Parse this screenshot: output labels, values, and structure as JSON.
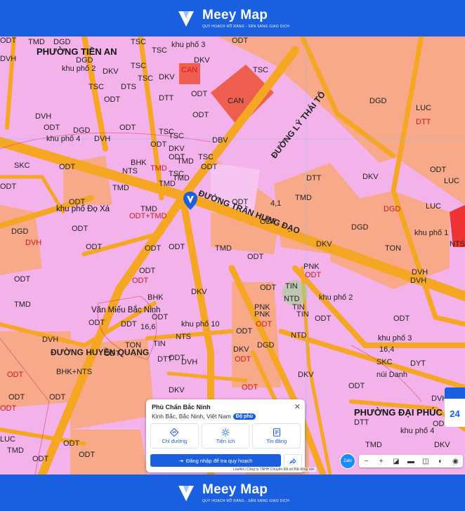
{
  "brand": {
    "name": "Meey Map",
    "tagline": "QUY HOẠCH RÕ RÀNG - SẴN SÀNG GIAO DỊCH"
  },
  "colors": {
    "primary": "#1a5fe0",
    "residential": "#f4b2ea",
    "commercial": "#f7a98a",
    "road": "#f5a623",
    "special": "#ef5f4f"
  },
  "map": {
    "labels": [
      {
        "t": "PHƯỜNG TIỀN AN",
        "c": "big"
      },
      {
        "t": "TMD"
      },
      {
        "t": "DGD"
      },
      {
        "t": "TSC"
      },
      {
        "t": "TSC"
      },
      {
        "t": "khu phố 3"
      },
      {
        "t": "ODT"
      },
      {
        "t": "khu phố 2"
      },
      {
        "t": "DKV"
      },
      {
        "t": "CAN",
        "c": "red"
      },
      {
        "t": "DKV"
      },
      {
        "t": "DGD"
      },
      {
        "t": "DVH"
      },
      {
        "t": "DKV"
      },
      {
        "t": "TSC"
      },
      {
        "t": "TSC"
      },
      {
        "t": "ODT"
      },
      {
        "t": "DTS"
      },
      {
        "t": "ODT"
      },
      {
        "t": "DTT"
      },
      {
        "t": "TSC"
      },
      {
        "t": "ĐƯỜNG LÝ THÁI TỔ",
        "c": "road"
      },
      {
        "t": "CAN"
      },
      {
        "t": "TSC"
      },
      {
        "t": "DGD"
      },
      {
        "t": "LUC"
      },
      {
        "t": "DTT",
        "c": "red"
      },
      {
        "t": "DVH"
      },
      {
        "t": "ODT"
      },
      {
        "t": "ODT"
      },
      {
        "t": "ODT"
      },
      {
        "t": "DGD"
      },
      {
        "t": "khu phố 4"
      },
      {
        "t": "DVH"
      },
      {
        "t": "ODT"
      },
      {
        "t": "TSC"
      },
      {
        "t": "DKV"
      },
      {
        "t": "DBV"
      },
      {
        "t": "TSC"
      },
      {
        "t": "TSC"
      },
      {
        "t": "ODT"
      },
      {
        "t": "TMD",
        "c": "red"
      },
      {
        "t": "SKC"
      },
      {
        "t": "ODT"
      },
      {
        "t": "TMD"
      },
      {
        "t": "TSC"
      },
      {
        "t": "NTS"
      },
      {
        "t": "BHK"
      },
      {
        "t": "TMD"
      },
      {
        "t": "TMD"
      },
      {
        "t": "ODT"
      },
      {
        "t": "DTT"
      },
      {
        "t": "DKV"
      },
      {
        "t": "ODT"
      },
      {
        "t": "LUC"
      },
      {
        "t": "ODT"
      },
      {
        "t": "ODT"
      },
      {
        "t": "TMD"
      },
      {
        "t": "khu phố Đọ Xá",
        "c": "place"
      },
      {
        "t": "TMD"
      },
      {
        "t": "ODT+TMD",
        "c": "red"
      },
      {
        "t": "ĐƯỜNG TRẦN HƯNG ĐẠO",
        "c": "road"
      },
      {
        "t": "ODT"
      },
      {
        "t": "ODT"
      },
      {
        "t": "4,1"
      },
      {
        "t": "TMD"
      },
      {
        "t": "DGD"
      },
      {
        "t": "LUC"
      },
      {
        "t": "DGD",
        "c": "red"
      },
      {
        "t": "DGD"
      },
      {
        "t": "DVH",
        "c": "red"
      },
      {
        "t": "ODT"
      },
      {
        "t": "ODT"
      },
      {
        "t": "ODT"
      },
      {
        "t": "ODT"
      },
      {
        "t": "TMD"
      },
      {
        "t": "DKV"
      },
      {
        "t": "TON"
      },
      {
        "t": "khu phố 1"
      },
      {
        "t": "NTS"
      },
      {
        "t": "DVH"
      },
      {
        "t": "ODT"
      },
      {
        "t": "ODT"
      },
      {
        "t": "ODT"
      },
      {
        "t": "PNK"
      },
      {
        "t": "ODT",
        "c": "red"
      },
      {
        "t": "DVH"
      },
      {
        "t": "ODT",
        "c": "red"
      },
      {
        "t": "TIN"
      },
      {
        "t": "TMD"
      },
      {
        "t": "BHK"
      },
      {
        "t": "DKV"
      },
      {
        "t": "ODT"
      },
      {
        "t": "PNK"
      },
      {
        "t": "TIN"
      },
      {
        "t": "NTD"
      },
      {
        "t": "khu phố 2"
      },
      {
        "t": "Văn Miếu Bắc Ninh",
        "c": "place"
      },
      {
        "t": "PNK"
      },
      {
        "t": "ODT",
        "c": "red"
      },
      {
        "t": "TIN"
      },
      {
        "t": "ODT"
      },
      {
        "t": "ODT"
      },
      {
        "t": "ODT"
      },
      {
        "t": "DDT"
      },
      {
        "t": "16,6"
      },
      {
        "t": "khu phố 10"
      },
      {
        "t": "ODT"
      },
      {
        "t": "NTD"
      },
      {
        "t": "ODT"
      },
      {
        "t": "DVH"
      },
      {
        "t": "TON"
      },
      {
        "t": "TIN"
      },
      {
        "t": "NTS"
      },
      {
        "t": "ODT"
      },
      {
        "t": "DGD"
      },
      {
        "t": "khu phố 3"
      },
      {
        "t": "ODT"
      },
      {
        "t": "DTT"
      },
      {
        "t": "DVH"
      },
      {
        "t": "DKV"
      },
      {
        "t": "ODT",
        "c": "red"
      },
      {
        "t": "16,4"
      },
      {
        "t": "DYT"
      },
      {
        "t": "ĐƯỜNG HUYỀN QUANG",
        "c": "road"
      },
      {
        "t": "BHK+NTS"
      },
      {
        "t": "ODT",
        "c": "red"
      },
      {
        "t": "ODT"
      },
      {
        "t": "SKC"
      },
      {
        "t": "núi Danh"
      },
      {
        "t": "ODT"
      },
      {
        "t": "DKV"
      },
      {
        "t": "ODT",
        "c": "red"
      },
      {
        "t": "DKV"
      },
      {
        "t": "ODT"
      },
      {
        "t": "PHƯỜNG ĐẠI PHÚC",
        "c": "big"
      },
      {
        "t": "ODT",
        "c": "red"
      },
      {
        "t": "LUC"
      },
      {
        "t": "ODT"
      },
      {
        "t": "khu phố 4"
      },
      {
        "t": "DTT"
      },
      {
        "t": "LUC"
      },
      {
        "t": "ODT"
      },
      {
        "t": "TMD"
      },
      {
        "t": "ODT"
      },
      {
        "t": "DKV"
      },
      {
        "t": "ODT"
      },
      {
        "t": "DVH"
      },
      {
        "t": "TMD"
      },
      {
        "t": "ODT"
      }
    ]
  },
  "popup": {
    "title": "Phù Chẩn Bắc Ninh",
    "address": "Kinh Bắc, Bắc Ninh, Việt Nam",
    "badge": "Độ phủ",
    "actions": [
      "Chỉ đường",
      "Tiện ích",
      "Tin đăng"
    ],
    "login": "Đăng nhập để tra quy hoạch"
  },
  "attribution": "Leaflet | Công ty TNHH Chuyển đổi số Bất động sản",
  "zalo": "Zalo",
  "ad_number": "24"
}
